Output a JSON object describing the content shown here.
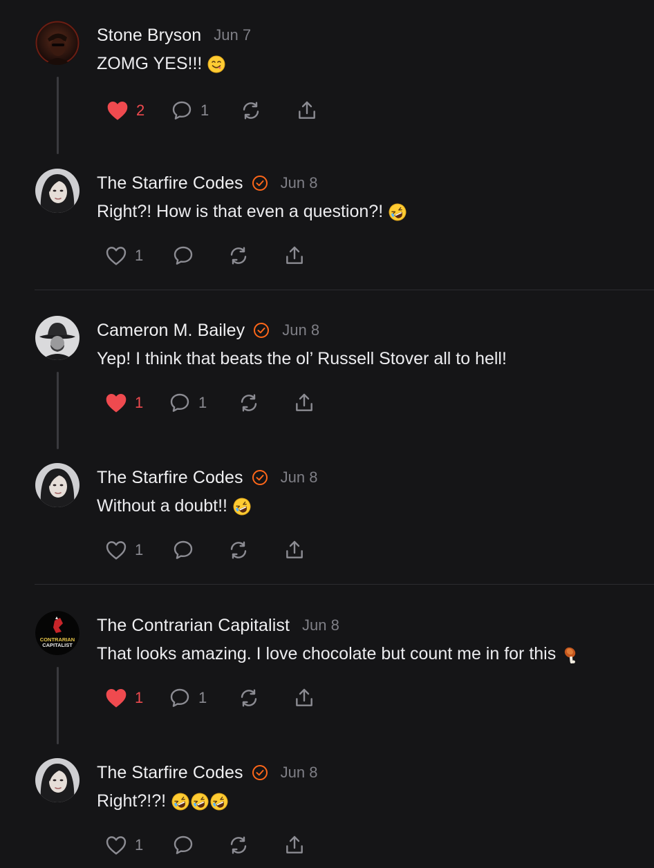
{
  "colors": {
    "background": "#151517",
    "text": "#ececef",
    "muted": "#7f7f86",
    "liked": "#ef4a4f",
    "verified": "#ff6719",
    "divider": "#2c2c30"
  },
  "comments": [
    {
      "author": "Stone Bryson",
      "verified": false,
      "date": "Jun 7",
      "text": "ZOMG YES!!!",
      "emojis": [
        "yum-emoji"
      ],
      "likes": "2",
      "liked": true,
      "replies": "1",
      "avatar": "stone-avatar",
      "thread_line": true
    },
    {
      "author": "The Starfire Codes",
      "verified": true,
      "date": "Jun 8",
      "text": "Right?! How is that even a question?!",
      "emojis": [
        "rofl-emoji"
      ],
      "likes": "1",
      "liked": false,
      "replies": "",
      "avatar": "starfire-avatar",
      "thread_line": false
    },
    {
      "author": "Cameron M. Bailey",
      "verified": true,
      "date": "Jun 8",
      "text": "Yep! I think that beats the ol’ Russell Stover all to hell!",
      "emojis": [],
      "likes": "1",
      "liked": true,
      "replies": "1",
      "avatar": "cameron-avatar",
      "thread_line": true
    },
    {
      "author": "The Starfire Codes",
      "verified": true,
      "date": "Jun 8",
      "text": "Without a doubt!!",
      "emojis": [
        "rofl-emoji"
      ],
      "likes": "1",
      "liked": false,
      "replies": "",
      "avatar": "starfire-avatar",
      "thread_line": false
    },
    {
      "author": "The Contrarian Capitalist",
      "verified": false,
      "date": "Jun 8",
      "text": "That looks amazing. I love chocolate but count me in for this",
      "emojis": [
        "meat-on-bone-emoji"
      ],
      "likes": "1",
      "liked": true,
      "replies": "1",
      "avatar": "contrarian-avatar",
      "avatar_text": [
        "CONTRARIAN",
        "CAPITALIST"
      ],
      "thread_line": true
    },
    {
      "author": "The Starfire Codes",
      "verified": true,
      "date": "Jun 8",
      "text": "Right?!?!",
      "emojis": [
        "rofl-emoji",
        "rofl-emoji",
        "rofl-emoji"
      ],
      "likes": "1",
      "liked": false,
      "replies": "",
      "avatar": "starfire-avatar",
      "thread_line": false
    }
  ]
}
